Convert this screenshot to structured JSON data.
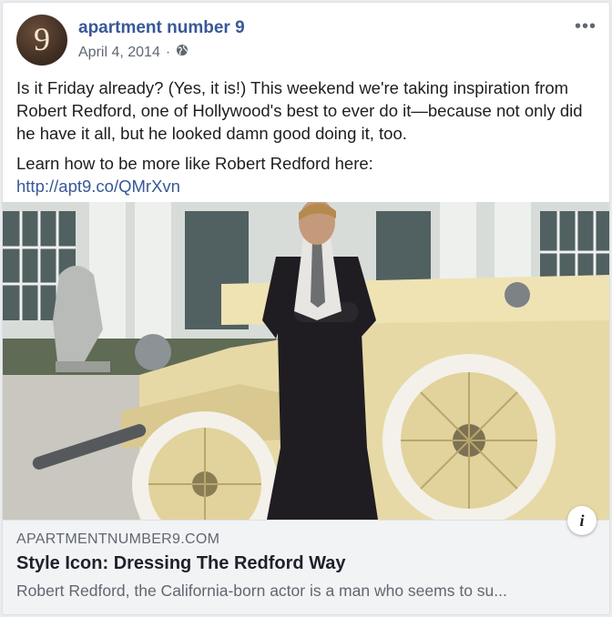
{
  "post": {
    "page_name": "apartment number 9",
    "avatar_glyph": "9",
    "date": "April 4, 2014",
    "separator": "·",
    "privacy_icon": "globe-icon",
    "more_icon": "more-options-icon",
    "more_glyph": "•••",
    "text_paragraph_1": "Is it Friday already? (Yes, it is!) This weekend we're taking inspiration from Robert Redford, one of Hollywood's best to ever do it—because not only did he have it all, but he looked damn good doing it, too.",
    "text_paragraph_2": "Learn how to be more like Robert Redford here:",
    "link_text": "http://apt9.co/QMrXvn"
  },
  "link_preview": {
    "domain": "APARTMENTNUMBER9.COM",
    "title": "Style Icon: Dressing The Redford Way",
    "description": "Robert Redford, the California-born actor is a man who seems to su...",
    "info_glyph": "i"
  },
  "colors": {
    "link_blue": "#385898",
    "meta_gray": "#606770",
    "preview_bg": "#f2f3f5",
    "car_cream": "#e7d9a6"
  }
}
